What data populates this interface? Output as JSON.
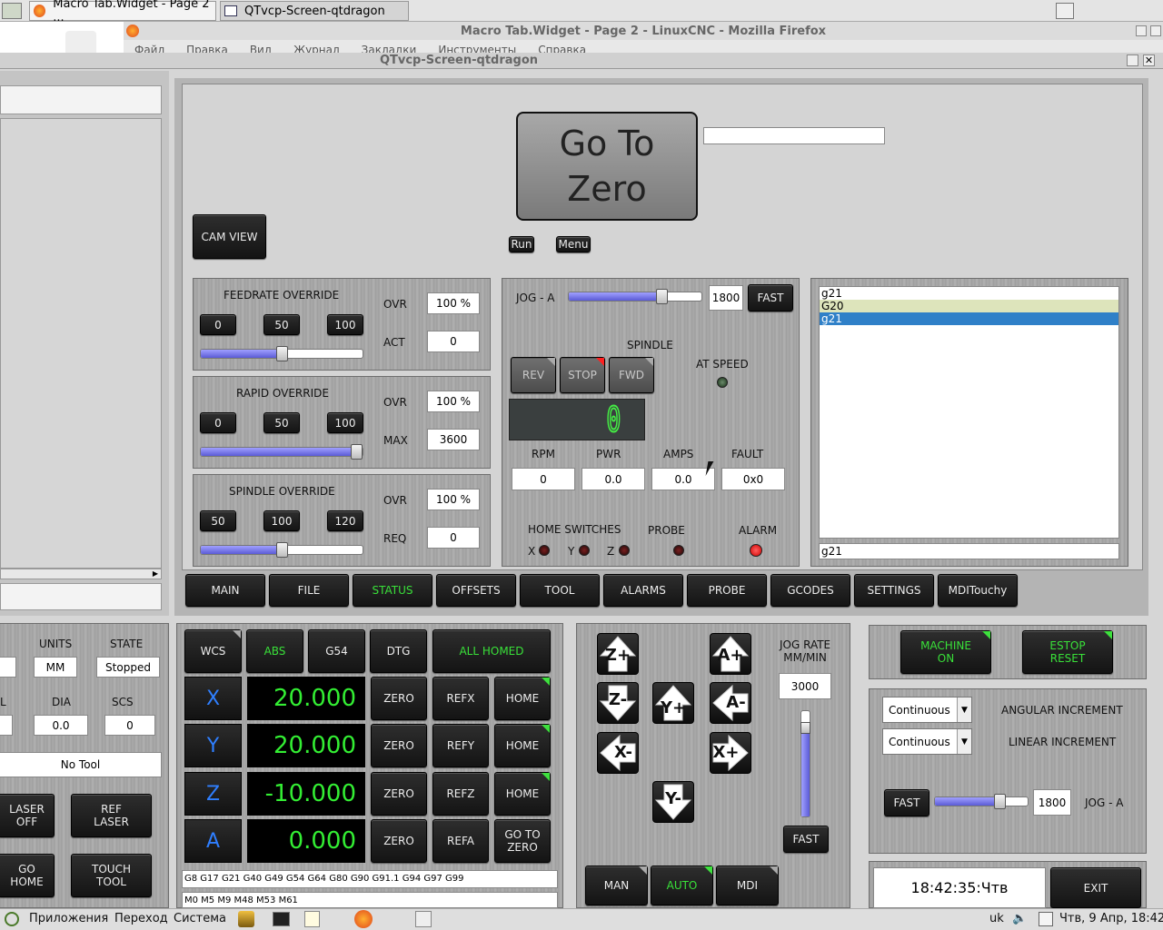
{
  "os_top": {
    "tab1_title": "Macro Tab.Widget - Page 2 ...",
    "tab2_title": "QTvcp-Screen-qtdragon"
  },
  "firefox": {
    "window_title": "Macro Tab.Widget - Page 2 - LinuxCNC - Mozilla Firefox",
    "menu": [
      "Файл",
      "Правка",
      "Вид",
      "Журнал",
      "Закладки",
      "Инструменты",
      "Справка"
    ]
  },
  "qt_window": {
    "title": "QTvcp-Screen-qtdragon"
  },
  "macro": {
    "go_to_zero_line1": "Go To",
    "go_to_zero_line2": "Zero",
    "entry_value": "",
    "run_label": "Run",
    "menu_label": "Menu",
    "cam_view_label": "CAM VIEW"
  },
  "feed": {
    "title": "FEEDRATE OVERRIDE",
    "buttons": [
      "0",
      "50",
      "100"
    ],
    "ovr_label": "OVR",
    "ovr_value": "100 %",
    "act_label": "ACT",
    "act_value": "0",
    "slider_fraction": 0.5
  },
  "rapid": {
    "title": "RAPID OVERRIDE",
    "buttons": [
      "0",
      "50",
      "100"
    ],
    "ovr_label": "OVR",
    "ovr_value": "100 %",
    "max_label": "MAX",
    "max_value": "3600",
    "slider_fraction": 1.0
  },
  "spindle_ovr": {
    "title": "SPINDLE OVERRIDE",
    "buttons": [
      "50",
      "100",
      "120"
    ],
    "ovr_label": "OVR",
    "ovr_value": "100 %",
    "req_label": "REQ",
    "req_value": "0",
    "slider_fraction": 0.5
  },
  "spindle": {
    "jog_label": "JOG - A",
    "jog_value": "1800",
    "fast_label": "FAST",
    "jog_fraction": 0.7,
    "title": "SPINDLE",
    "rev": "REV",
    "stop": "STOP",
    "fwd": "FWD",
    "at_speed": "AT SPEED",
    "lcd": "0",
    "rpm_label": "RPM",
    "rpm_value": "0",
    "pwr_label": "PWR",
    "pwr_value": "0.0",
    "amps_label": "AMPS",
    "amps_value": "0.0",
    "fault_label": "FAULT",
    "fault_value": "0x0",
    "home_switches": "HOME SWITCHES",
    "probe": "PROBE",
    "alarm": "ALARM",
    "x": "X",
    "y": "Y",
    "z": "Z"
  },
  "mdi": {
    "history": [
      "g21",
      "G20",
      "g21"
    ],
    "input_value": "g21"
  },
  "tabs": [
    "MAIN",
    "FILE",
    "STATUS",
    "OFFSETS",
    "TOOL",
    "ALARMS",
    "PROBE",
    "GCODES",
    "SETTINGS",
    "MDITouchy"
  ],
  "left_info": {
    "units_label": "UNITS",
    "units_value": "MM",
    "state_label": "STATE",
    "state_value": "Stopped",
    "l_label": "L",
    "dia_label": "DIA",
    "dia_value": "0.0",
    "scs_label": "SCS",
    "scs_value": "0",
    "tool_value": "No Tool",
    "laser_off": [
      "LASER",
      "OFF"
    ],
    "ref_laser": [
      "REF",
      "LASER"
    ],
    "go_home": [
      "GO",
      "HOME"
    ],
    "touch_tool": [
      "TOUCH",
      "TOOL"
    ]
  },
  "dro": {
    "wcs": "WCS",
    "abs": "ABS",
    "g54": "G54",
    "dtg": "DTG",
    "all_homed": "ALL HOMED",
    "rows": [
      {
        "axis": "X",
        "value": "20.000",
        "zero": "ZERO",
        "ref": "REFX",
        "home": "HOME"
      },
      {
        "axis": "Y",
        "value": "20.000",
        "zero": "ZERO",
        "ref": "REFY",
        "home": "HOME"
      },
      {
        "axis": "Z",
        "value": "-10.000",
        "zero": "ZERO",
        "ref": "REFZ",
        "home": "HOME"
      },
      {
        "axis": "A",
        "value": "0.000",
        "zero": "ZERO",
        "ref": "REFA",
        "home": "GO TO ZERO"
      }
    ],
    "gcodes": "G8 G17 G21 G40 G49 G54 G64 G80 G90 G91.1 G94 G97 G99",
    "mcodes": "M0 M5 M9 M48 M53 M61"
  },
  "jogpad": {
    "zplus": "Z+",
    "zminus": "Z-",
    "yplus": "Y+",
    "yminus": "Y-",
    "xplus": "X+",
    "xminus": "X-",
    "aplus": "A+",
    "aminus": "A-",
    "rate_label1": "JOG RATE",
    "rate_label2": "MM/MIN",
    "rate_value": "3000",
    "fast_label": "FAST",
    "man": "MAN",
    "auto": "AUTO",
    "mdi": "MDI",
    "rate_fraction": 0.95
  },
  "machine": {
    "machine_on": [
      "MACHINE",
      "ON"
    ],
    "estop_reset": [
      "ESTOP",
      "RESET"
    ],
    "angular_combo": "Continuous",
    "angular_label": "ANGULAR INCREMENT",
    "linear_combo": "Continuous",
    "linear_label": "LINEAR INCREMENT",
    "fast_label": "FAST",
    "jog_value": "1800",
    "jog_label": "JOG - A",
    "jog_fraction": 0.7,
    "clock": "18:42:35:Чтв",
    "exit": "EXIT"
  },
  "taskbar": {
    "apps": "Приложения",
    "places": "Переход",
    "system": "Система",
    "lang": "uk",
    "datetime": "Чтв, 9 Апр, 18:42"
  }
}
